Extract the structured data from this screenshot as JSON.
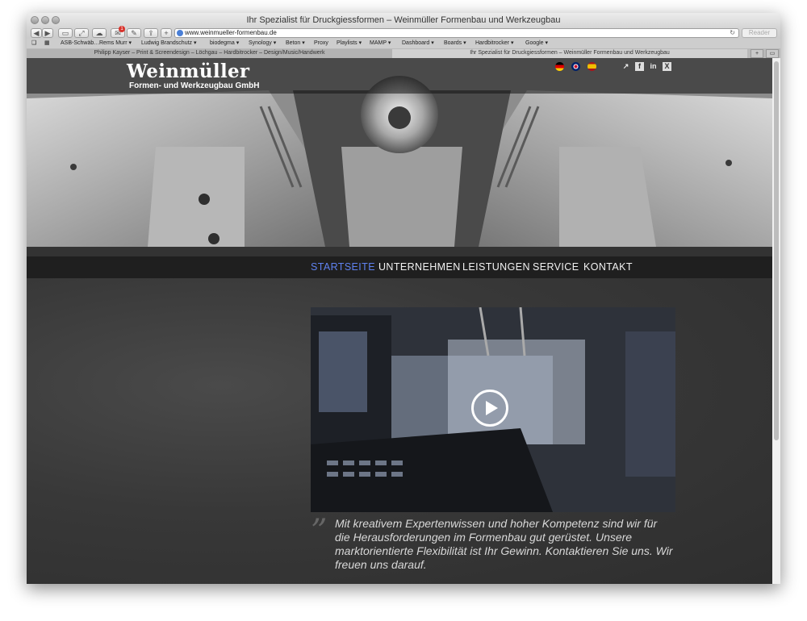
{
  "browser": {
    "window_title": "Ihr Spezialist für Druckgiessformen – Weinmüller Formenbau und Werkzeugbau",
    "url": "www.weinmueller-formenbau.de",
    "reader_label": "Reader",
    "notification_count": "1",
    "bookmarks": [
      "ASB-Schwäb…",
      "Rems Murr ▾",
      "Ludwig Brandschutz ▾",
      "biodegma ▾",
      "Synology ▾",
      "Beton ▾",
      "Proxy",
      "Playlists ▾",
      "MAMP ▾",
      "Dashboard ▾",
      "Boards ▾",
      "Hardbitrocker ▾",
      "Google ▾"
    ],
    "tabs": [
      {
        "label": "Philipp Kayser – Print & Screendesign – Löchgau – Hardbitrocker – Design/Music/Handwerk",
        "active": false
      },
      {
        "label": "Ihr Spezialist für Druckgiessformen – Weinmüller Formenbau und Werkzeugbau",
        "active": true
      }
    ],
    "icons": [
      "back-icon",
      "forward-icon",
      "sidebar-icon",
      "fullscreen-icon",
      "cloud-tabs-icon",
      "notifications-icon",
      "tools-icon",
      "share-icon",
      "new-tab-icon",
      "globe-icon",
      "reload-icon",
      "bookmarks-book-icon",
      "top-sites-grid-icon"
    ]
  },
  "site": {
    "logo_name": "Weinmüller",
    "logo_subtitle": "Formen- und Werkzeugbau GmbH",
    "languages": [
      "de-flag-icon",
      "uk-flag-icon",
      "es-flag-icon"
    ],
    "social": [
      "share-icon",
      "facebook-icon",
      "linkedin-icon",
      "xing-icon"
    ],
    "nav": [
      {
        "label": "STARTSEITE",
        "active": true
      },
      {
        "label": "UNTERNEHMEN",
        "active": false
      },
      {
        "label": "LEISTUNGEN",
        "active": false
      },
      {
        "label": "SERVICE",
        "active": false
      },
      {
        "label": "KONTAKT",
        "active": false
      }
    ],
    "quote_mark": "”",
    "quote_text": "Mit kreativem Expertenwissen und hoher Kompetenz sind wir für die Herausforderungen im Formenbau gut gerüstet. Unsere marktorientierte Flexibilität ist Ihr Gewinn. Kontaktieren Sie uns. Wir freuen uns darauf.",
    "colors": {
      "nav_active": "#5f82f0",
      "nav_bg": "#1f1f1f",
      "content_bg": "#333333"
    }
  }
}
